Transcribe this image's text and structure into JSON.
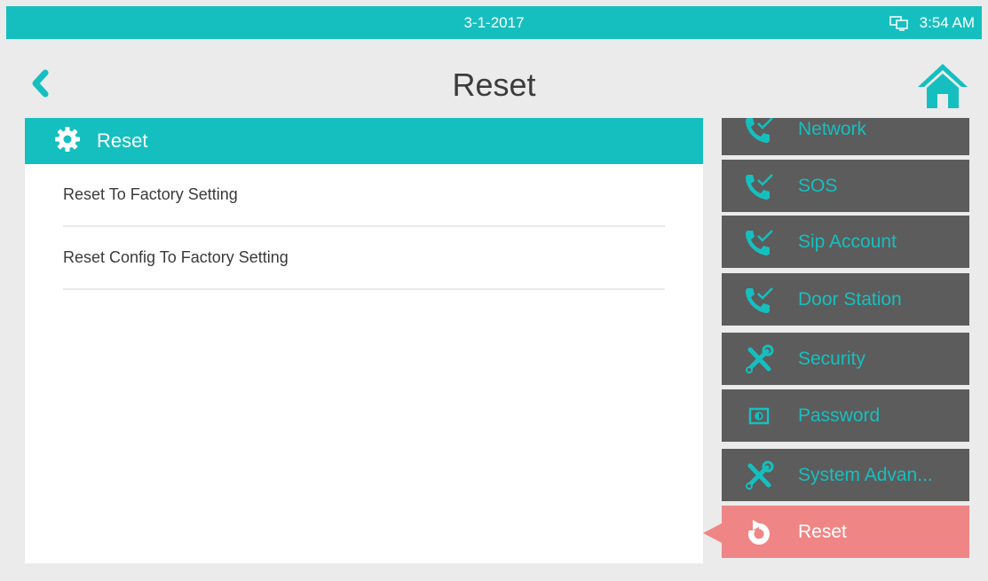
{
  "status_bar": {
    "date": "3-1-2017",
    "time": "3:54 AM",
    "icon": "network-status-icon"
  },
  "header": {
    "title": "Reset",
    "back_icon": "chevron-left-icon",
    "home_icon": "home-icon"
  },
  "panel": {
    "title": "Reset",
    "icon": "gear-icon",
    "items": [
      {
        "label": "Reset To Factory Setting"
      },
      {
        "label": "Reset Config To Factory Setting"
      }
    ]
  },
  "sidebar": {
    "items": [
      {
        "label": "Network",
        "icon": "phone-check-icon"
      },
      {
        "label": "SOS",
        "icon": "phone-check-icon"
      },
      {
        "label": "Sip Account",
        "icon": "phone-check-icon"
      },
      {
        "label": "Door Station",
        "icon": "phone-check-icon"
      },
      {
        "label": "Security",
        "icon": "tools-icon"
      },
      {
        "label": "Password",
        "icon": "password-icon"
      },
      {
        "label": "System Advan...",
        "icon": "tools-icon"
      },
      {
        "label": "Reset",
        "icon": "reset-icon",
        "active": true
      }
    ]
  },
  "colors": {
    "accent": "#16bfbf",
    "sidebar_bg": "#5c5c5c",
    "active_bg": "#f08585",
    "background": "#ebebeb"
  }
}
